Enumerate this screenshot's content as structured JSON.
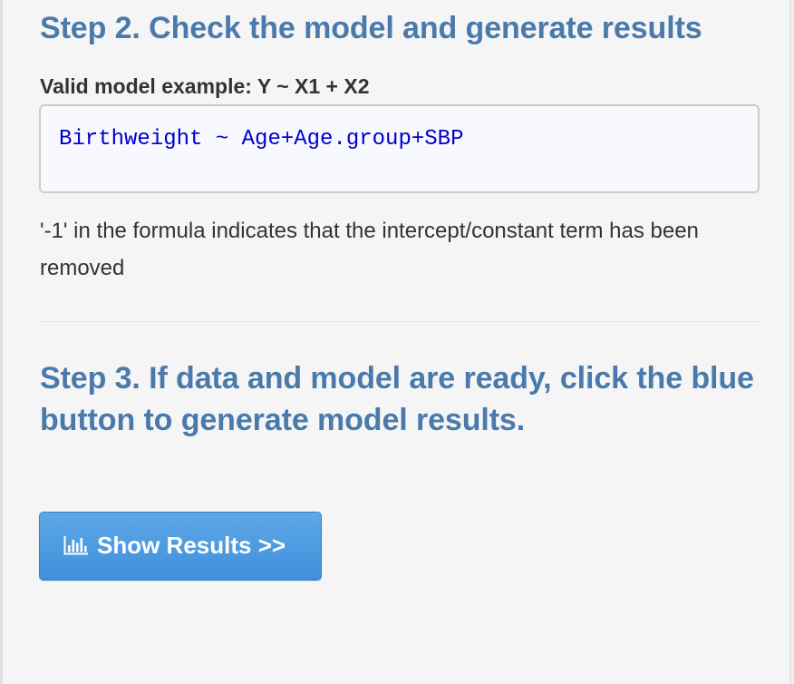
{
  "step2": {
    "heading": "Step 2. Check the model and generate results",
    "model_example_label": "Valid model example: Y ~ X1 + X2",
    "model_formula": "Birthweight ~ Age+Age.group+SBP",
    "note": "'-1' in the formula indicates that the intercept/constant term has been removed"
  },
  "step3": {
    "heading": "Step 3. If data and model are ready, click the blue button to generate model results.",
    "button_label": "Show Results >>",
    "button_icon": "bar-chart-icon"
  },
  "colors": {
    "heading": "#4a7aab",
    "formula": "#0000cc",
    "button": "#4a9be0",
    "panel_background": "#f5f5f5"
  }
}
